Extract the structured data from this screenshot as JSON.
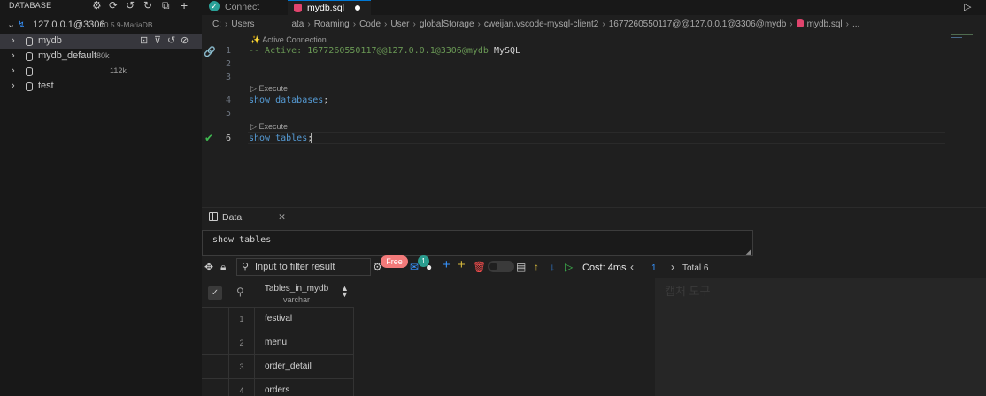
{
  "sidebar": {
    "title": "DATABASE",
    "connection": {
      "label": "127.0.0.1@3306",
      "version": "10.5.9-MariaDB"
    },
    "databases": [
      {
        "name": "mydb",
        "size": ""
      },
      {
        "name": "mydb_default",
        "size": "80k"
      },
      {
        "name": "",
        "size": "112k"
      },
      {
        "name": "test",
        "size": ""
      }
    ]
  },
  "tabs": [
    {
      "label": "Connect"
    },
    {
      "label": "mydb.sql"
    }
  ],
  "breadcrumb": [
    "C:",
    "Users",
    "ata",
    "Roaming",
    "Code",
    "User",
    "globalStorage",
    "cweijan.vscode-mysql-client2",
    "1677260550117@@127.0.0.1@3306@mydb",
    "mydb.sql",
    "..."
  ],
  "editor": {
    "codelens_active": "Active Connection",
    "codelens_execute": "Execute",
    "line1_comment": "-- Active: 1677260550117@@127.0.0.1@3306@mydb",
    "line1_tail": "MySQL",
    "line4_kw": "show databases",
    "line6_kw": "show tables",
    "semicolon": ";",
    "line_numbers": [
      "1",
      "2",
      "3",
      "4",
      "5",
      "6"
    ]
  },
  "panel": {
    "tab_label": "Data",
    "query_text": "show tables",
    "filter_placeholder": "Input to filter result",
    "free_badge": "Free",
    "notification_count": "1",
    "cost": "Cost: 4ms",
    "page": "1",
    "total": "Total 6"
  },
  "result_table": {
    "column": "Tables_in_mydb",
    "column_type": "varchar",
    "rows": [
      {
        "num": "1",
        "value": "festival"
      },
      {
        "num": "2",
        "value": "menu"
      },
      {
        "num": "3",
        "value": "order_detail"
      },
      {
        "num": "4",
        "value": "orders"
      }
    ]
  },
  "overlay": {
    "capture_tool": "캡처 도구"
  },
  "colors": {
    "accent": "#0078d4",
    "keyword": "#569cd6",
    "comment": "#6a9955",
    "success": "#2aa198",
    "badge": "#f27a7a"
  }
}
